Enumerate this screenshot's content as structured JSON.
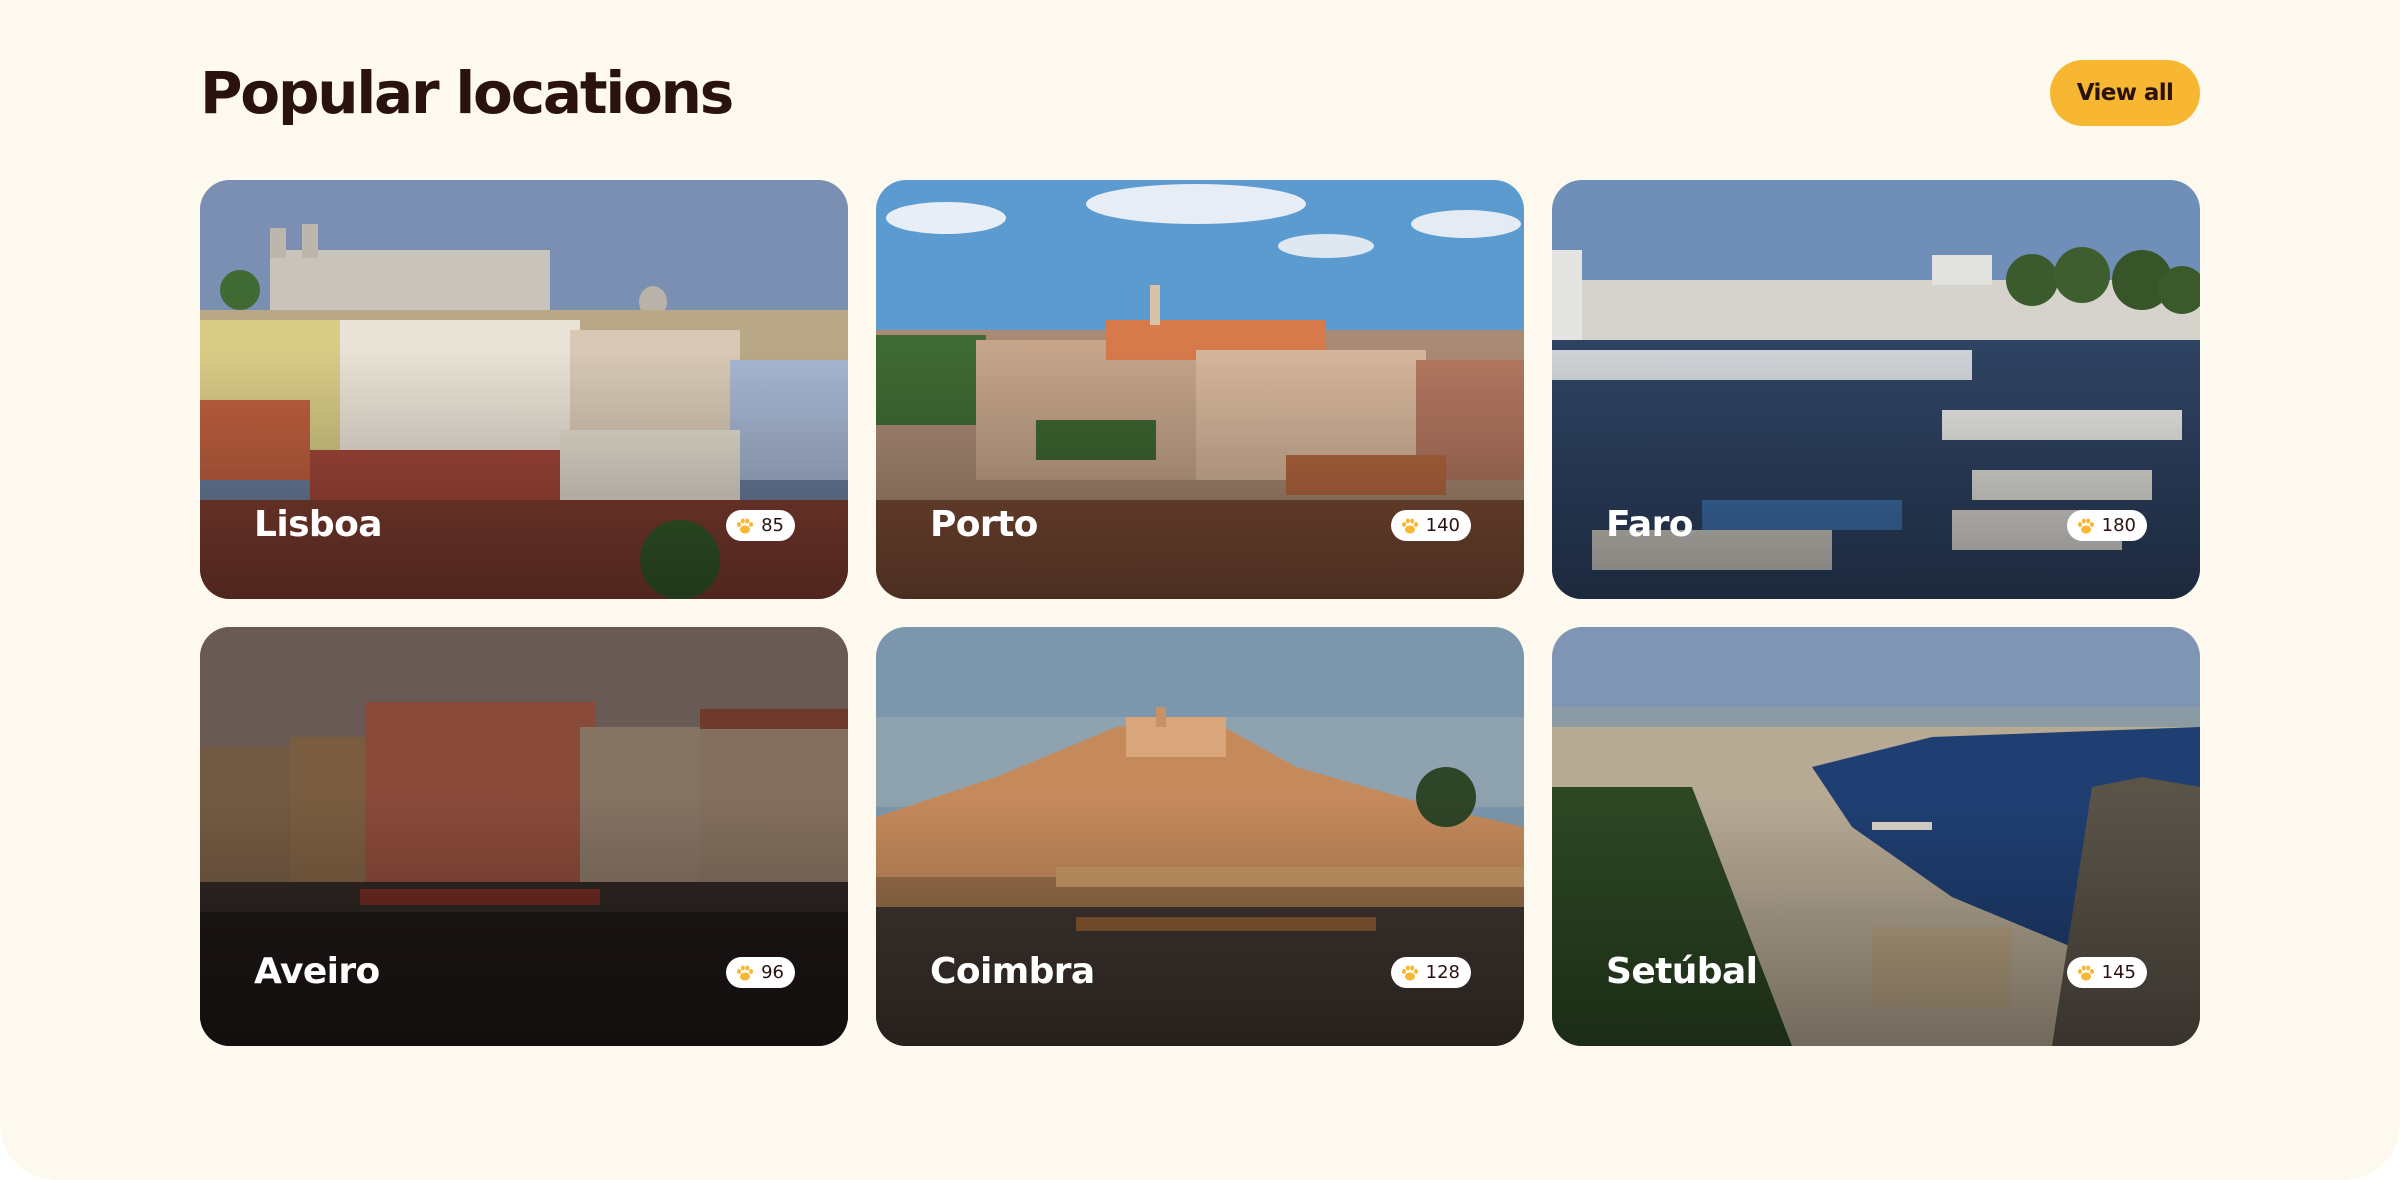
{
  "header": {
    "title": "Popular locations",
    "view_all_label": "View all"
  },
  "colors": {
    "background": "#fdf9ee",
    "accent": "#f7b733",
    "text": "#2a130f"
  },
  "locations": [
    {
      "name": "Lisboa",
      "count": "85",
      "icon": "paw-icon"
    },
    {
      "name": "Porto",
      "count": "140",
      "icon": "paw-icon"
    },
    {
      "name": "Faro",
      "count": "180",
      "icon": "paw-icon"
    },
    {
      "name": "Aveiro",
      "count": "96",
      "icon": "paw-icon"
    },
    {
      "name": "Coimbra",
      "count": "128",
      "icon": "paw-icon"
    },
    {
      "name": "Setúbal",
      "count": "145",
      "icon": "paw-icon"
    }
  ]
}
